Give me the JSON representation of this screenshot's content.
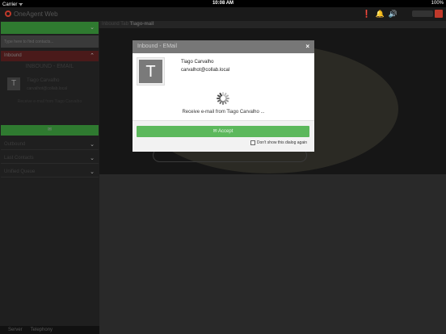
{
  "status_bar": {
    "carrier": "Carrier ᯤ",
    "time": "10:08 AM",
    "battery": "100%"
  },
  "header": {
    "app_title": "OneAgent Web",
    "icons": [
      "alert-icon",
      "bell-icon",
      "volume-icon"
    ]
  },
  "sidebar": {
    "search_placeholder": "Type here to find contacts...",
    "section_title": "Inbound",
    "active_contact_heading": "INBOUND - EMAIL",
    "contact": {
      "initial": "T",
      "name": "Tiago Carvalho",
      "email": "carvalhot@collab.local",
      "status": "Receive e-mail from Tiago Carvalho"
    },
    "green_button_icon": "✉",
    "rows": [
      "Outbound",
      "Last Contacts",
      "Unified Queue"
    ]
  },
  "bottom_tabs": [
    "Server",
    "Telephony"
  ],
  "breadcrumb": {
    "prefix": "Inbound Tab",
    "current": "Tiago-mail"
  },
  "modal": {
    "title": "Inbound - EMail",
    "close": "×",
    "avatar_initial": "T",
    "name": "Tiago Carvalho",
    "email": "carvalhot@collab.local",
    "status": "Receive e-mail from Tiago Carvalho ...",
    "accept_label": "Accept",
    "dont_show_label": "Don't show this dialog again"
  },
  "colors": {
    "accent_green": "#5cb85c",
    "brand_red": "#c0392b",
    "modal_header": "#777777"
  }
}
